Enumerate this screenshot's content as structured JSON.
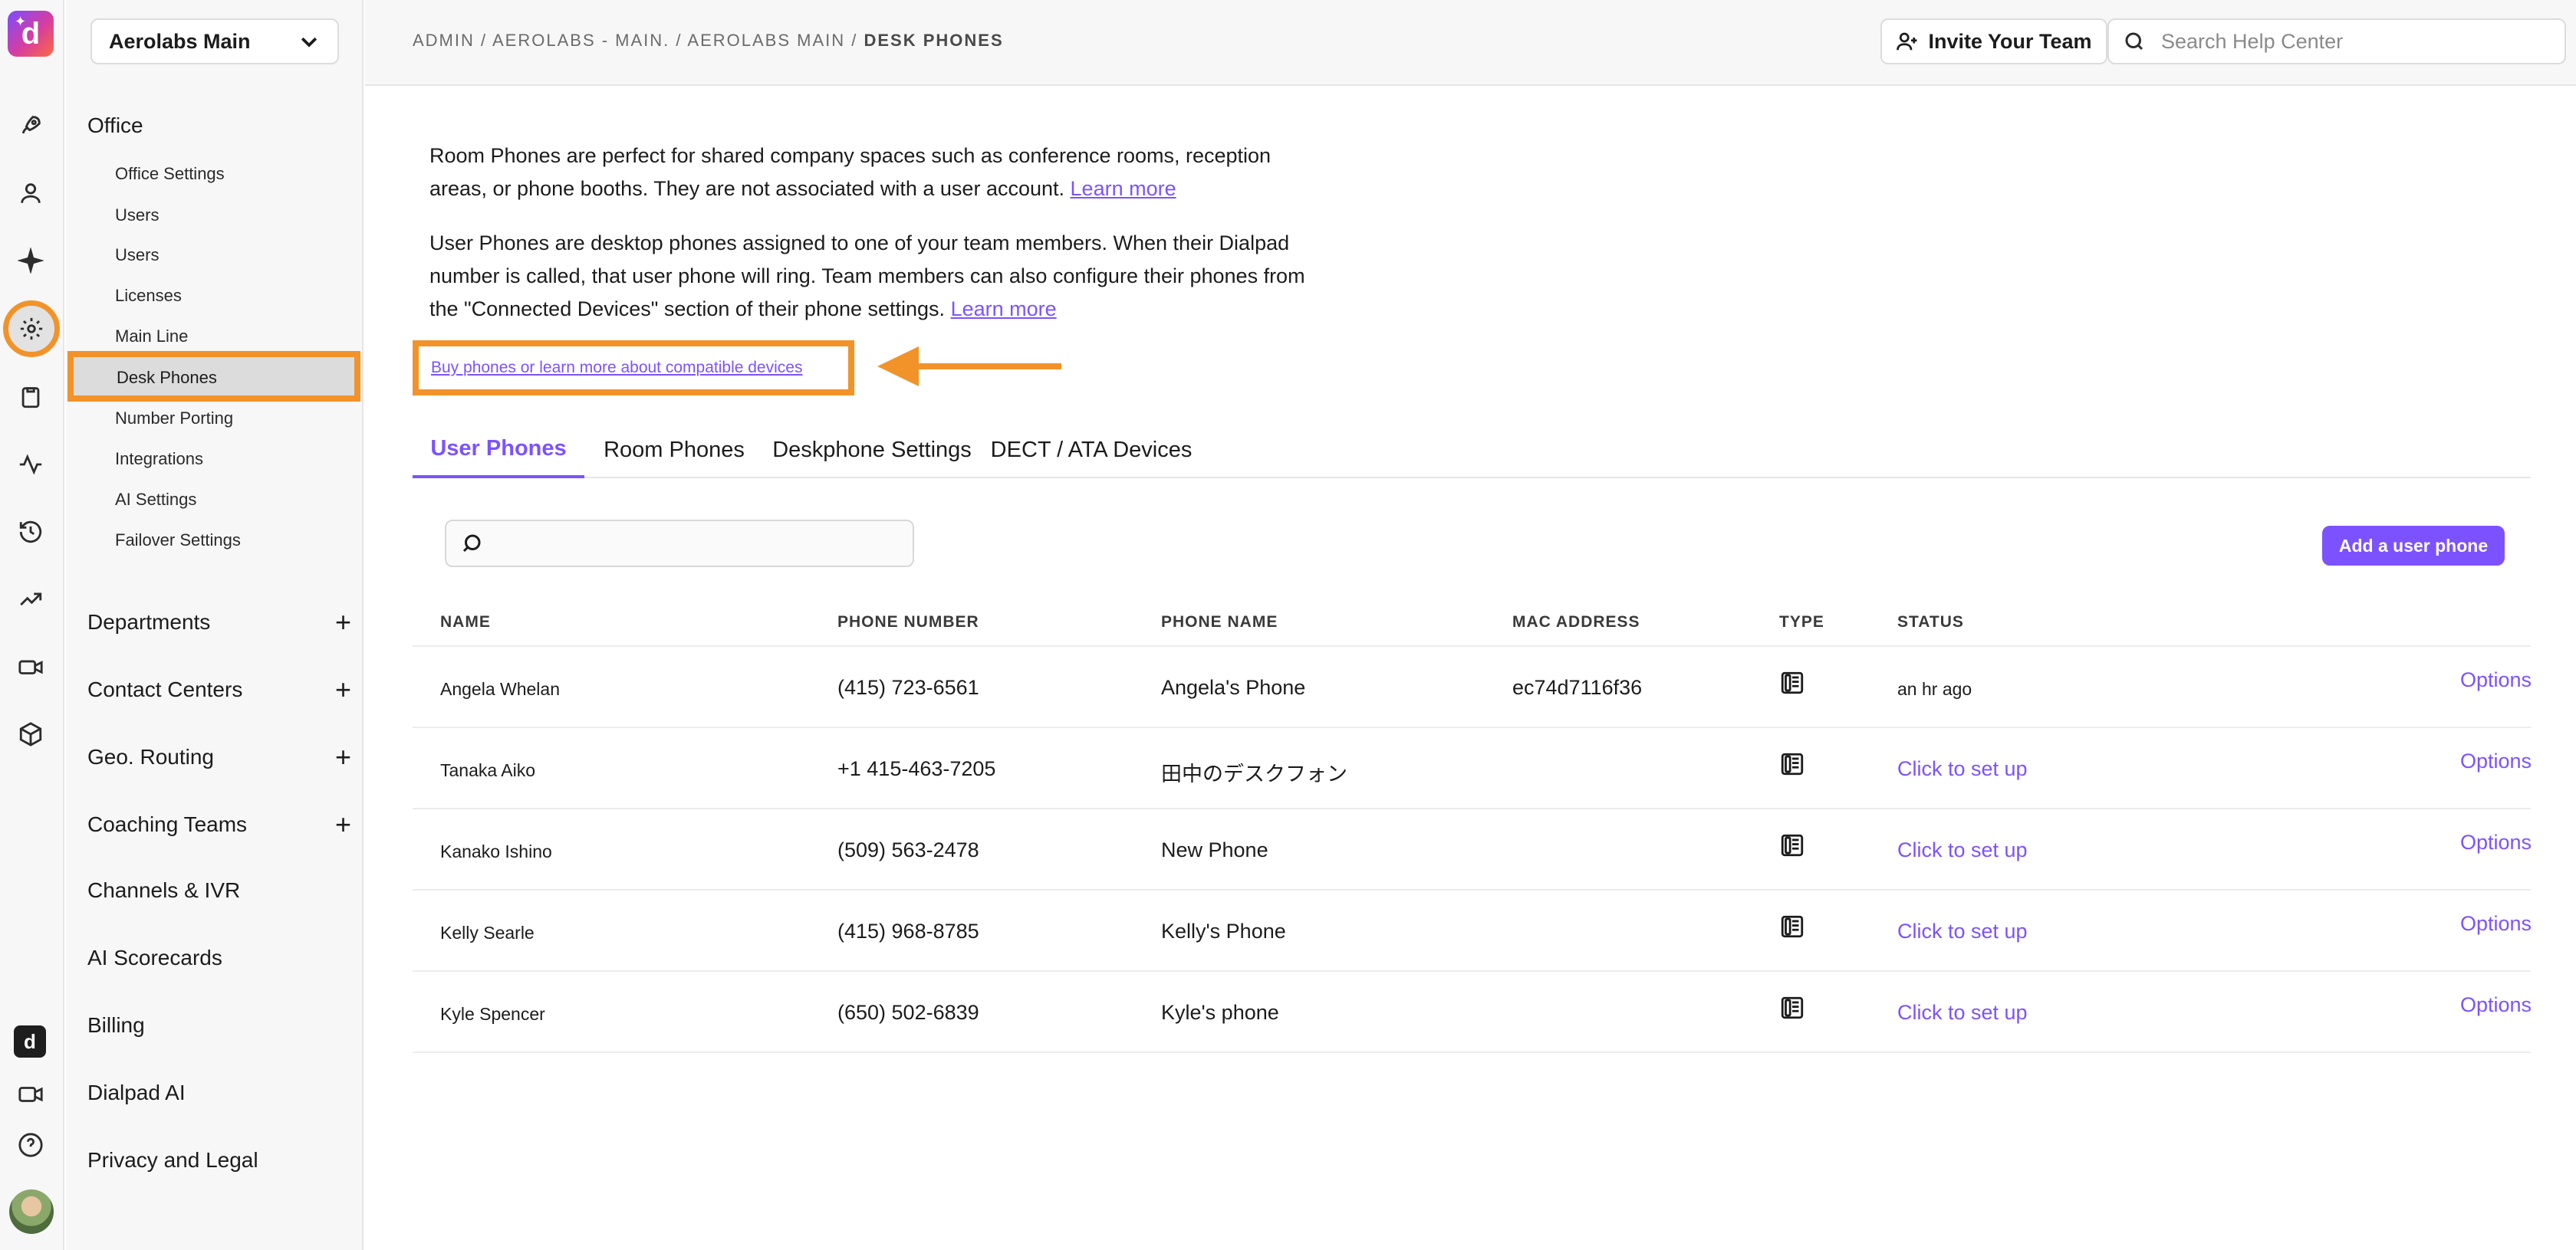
{
  "rail": {
    "logo_letter": "d",
    "icons": [
      "rocket-icon",
      "user-icon",
      "sparkle-icon",
      "gear-icon",
      "clipboard-icon",
      "activity-icon",
      "history-icon",
      "trend-icon",
      "camera-icon",
      "cube-icon",
      "dialpad-icon",
      "video-icon",
      "help-icon",
      "avatar"
    ]
  },
  "sidebar": {
    "org_name": "Aerolabs Main",
    "office_label": "Office",
    "office_items": [
      "Office Settings",
      "Users",
      "Users",
      "Licenses",
      "Main Line",
      "Desk Phones",
      "Number Porting",
      "Integrations",
      "AI Settings",
      "Failover Settings"
    ],
    "sections": [
      "Departments",
      "Contact Centers",
      "Geo. Routing",
      "Coaching Teams",
      "Channels & IVR",
      "AI Scorecards",
      "Billing",
      "Dialpad AI",
      "Privacy and Legal"
    ],
    "plus": "+"
  },
  "topbar": {
    "breadcrumb_prefix": "ADMIN / AEROLABS - MAIN. / AEROLABS MAIN / ",
    "breadcrumb_current": "DESK PHONES",
    "invite_label": "Invite Your Team",
    "search_placeholder": "Search Help Center"
  },
  "intro": {
    "room_text": "Room Phones are perfect for shared company spaces such as conference rooms, reception areas, or phone booths. They are not associated with a user account.",
    "user_text": "User Phones are desktop phones assigned to one of your team members. When their Dialpad number is called, that user phone will ring. Team members can also configure their phones from the \"Connected Devices\" section of their phone settings.",
    "learn_more": "Learn more",
    "buy_link": "Buy phones or learn more about compatible devices"
  },
  "tabs": [
    "User Phones",
    "Room Phones",
    "Deskphone Settings",
    "DECT / ATA Devices"
  ],
  "table": {
    "search_placeholder": "",
    "add_button": "Add a user phone",
    "headers": [
      "NAME",
      "PHONE NUMBER",
      "PHONE NAME",
      "MAC ADDRESS",
      "TYPE",
      "STATUS"
    ],
    "rows": [
      {
        "name": "Angela Whelan",
        "number": "(415) 723-6561",
        "phone_name": "Angela's Phone",
        "mac": "ec74d7116f36",
        "status": "an hr ago",
        "options": "Options"
      },
      {
        "name": "Tanaka Aiko",
        "number": "+1 415-463-7205",
        "phone_name": "田中のデスクフォン",
        "mac": "",
        "status": "Click to set up",
        "options": "Options"
      },
      {
        "name": "Kanako Ishino",
        "number": "(509) 563-2478",
        "phone_name": "New Phone",
        "mac": "",
        "status": "Click to set up",
        "options": "Options"
      },
      {
        "name": "Kelly Searle",
        "number": "(415) 968-8785",
        "phone_name": "Kelly's Phone",
        "mac": "",
        "status": "Click to set up",
        "options": "Options"
      },
      {
        "name": "Kyle Spencer",
        "number": "(650) 502-6839",
        "phone_name": "Kyle's phone",
        "mac": "",
        "status": "Click to set up",
        "options": "Options"
      }
    ]
  },
  "colors": {
    "accent": "#7c52ff",
    "highlight": "#f2932a"
  }
}
